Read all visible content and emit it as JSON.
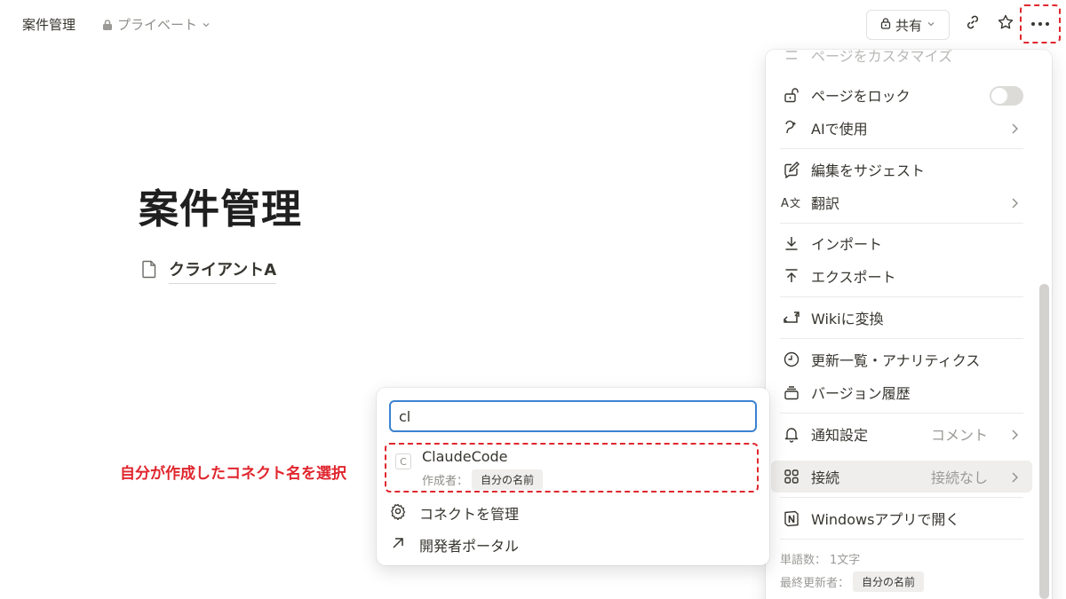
{
  "topbar": {
    "title": "案件管理",
    "privacy": "プライベート",
    "share_label": "共有"
  },
  "page": {
    "title": "案件管理",
    "subpage": "クライアントA"
  },
  "menu": {
    "customize": "ページをカスタマイズ",
    "lock": "ページをロック",
    "ai_use": "AIで使用",
    "suggest_edits": "編集をサジェスト",
    "translate": "翻訳",
    "import": "インポート",
    "export": "エクスポート",
    "wiki": "Wikiに変換",
    "updates": "更新一覧・アナリティクス",
    "versions": "バージョン履歴",
    "notifications": "通知設定",
    "notifications_value": "コメント",
    "connections": "接続",
    "connections_value": "接続なし",
    "open_app": "Windowsアプリで開く",
    "word_count_label": "単語数：",
    "word_count_value": "1文字",
    "last_editor_label": "最終更新者：",
    "last_editor_value": "自分の名前"
  },
  "popup": {
    "search_value": "cl",
    "result_icon": "C",
    "result_name": "ClaudeCode",
    "result_author_label": "作成者：",
    "result_author": "自分の名前",
    "manage": "コネクトを管理",
    "developer_portal": "開発者ポータル"
  },
  "annotation": "自分が作成したコネクト名を選択",
  "colors": {
    "annotation_red": "#e0262e",
    "focus_blue": "#3b82d1",
    "text": "#37352f",
    "muted": "#9b9a97"
  }
}
